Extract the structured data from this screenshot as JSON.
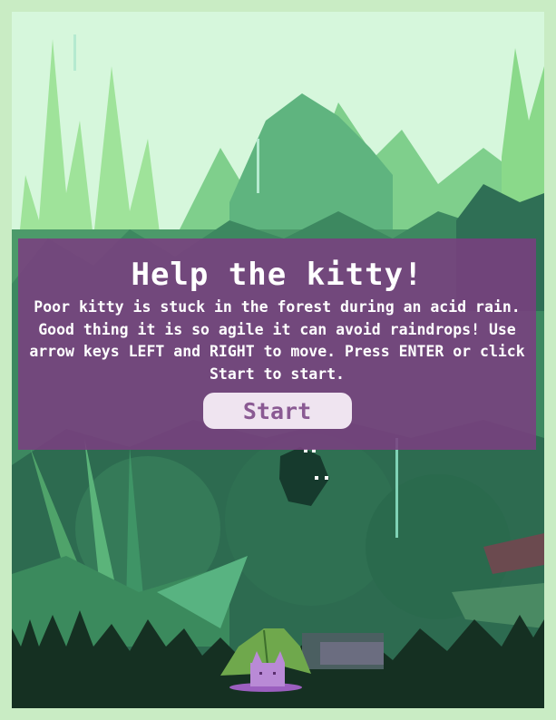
{
  "game": {
    "title": "Help the kitty!",
    "description": "Poor kitty is stuck in the forest during an acid rain. Good thing it is so agile it can avoid raindrops! Use arrow keys LEFT and RIGHT to move. Press ENTER or click Start to start.",
    "start_label": "Start"
  },
  "colors": {
    "border": "#c9ecc4",
    "sky": "#d6f7dc",
    "overlay": "#7a3f80",
    "button_bg": "#efe4f0",
    "button_text": "#8a5a93",
    "kitty": "#b98ad6",
    "leaf": "#6fa84c"
  },
  "icons": [
    "kitty-sprite",
    "leaf-umbrella-icon",
    "shadow-creature"
  ]
}
